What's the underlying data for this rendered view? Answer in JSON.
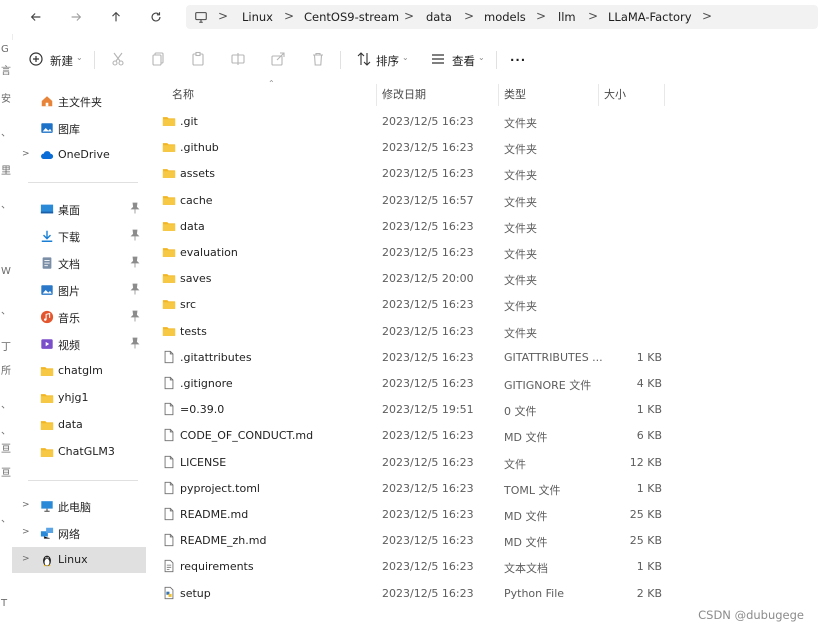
{
  "background_strip": {
    "chars": [
      "G",
      "言",
      "安",
      "、",
      "里",
      "、",
      "W",
      "、",
      "丁",
      "所",
      "、",
      "、",
      "亘",
      "亘",
      "、",
      "T"
    ]
  },
  "address_bar": {
    "back_icon": "arrow-left-icon",
    "forward_icon": "arrow-right-icon",
    "up_icon": "arrow-up-icon",
    "refresh_icon": "refresh-icon",
    "location_icon": "monitor-icon",
    "breadcrumbs": [
      "Linux",
      "CentOS9-stream",
      "data",
      "models",
      "llm",
      "LLaMA-Factory"
    ],
    "separator": ">"
  },
  "toolbar": {
    "new_label": "新建",
    "sort_label": "排序",
    "view_label": "查看",
    "more_label": "···",
    "icons": [
      "plus-circle-icon",
      "cut-icon",
      "copy-icon",
      "paste-icon",
      "rename-icon",
      "share-icon",
      "delete-icon",
      "sort-icon",
      "view-icon"
    ]
  },
  "nav": {
    "items": [
      {
        "label": "主文件夹",
        "icon": "home-icon",
        "color": "#e8833a"
      },
      {
        "label": "图库",
        "icon": "gallery-icon",
        "color": "#1e73c8"
      },
      {
        "label": "OneDrive",
        "icon": "cloud-icon",
        "color": "#0a6cd6",
        "expander": ">"
      },
      {
        "label": "桌面",
        "icon": "desktop-icon",
        "color": "#2b8ad8",
        "pinned": true
      },
      {
        "label": "下载",
        "icon": "download-icon",
        "color": "#1a7fd4",
        "pinned": true
      },
      {
        "label": "文档",
        "icon": "document-icon",
        "color": "#7a8ea6",
        "pinned": true
      },
      {
        "label": "图片",
        "icon": "pictures-icon",
        "color": "#2a78c7",
        "pinned": true
      },
      {
        "label": "音乐",
        "icon": "music-icon",
        "color": "#e4572e",
        "pinned": true
      },
      {
        "label": "视频",
        "icon": "video-icon",
        "color": "#7b4fc9",
        "pinned": true
      },
      {
        "label": "chatglm",
        "icon": "folder-icon",
        "color": "#f2b624"
      },
      {
        "label": "yhjg1",
        "icon": "folder-icon",
        "color": "#f2b624"
      },
      {
        "label": "data",
        "icon": "folder-icon",
        "color": "#f2b624"
      },
      {
        "label": "ChatGLM3",
        "icon": "folder-icon",
        "color": "#f2b624"
      },
      {
        "label": "此电脑",
        "icon": "computer-icon",
        "color": "#2b8ad8",
        "expander": ">"
      },
      {
        "label": "网络",
        "icon": "network-icon",
        "color": "#2b8ad8",
        "expander": ">"
      },
      {
        "label": "Linux",
        "icon": "tux-icon",
        "color": "#222222",
        "expander": ">",
        "selected": true
      }
    ]
  },
  "columns": {
    "name": "名称",
    "modified": "修改日期",
    "type": "类型",
    "size": "大小"
  },
  "files": [
    {
      "name": ".git",
      "modified": "2023/12/5 16:23",
      "type": "文件夹",
      "size": "",
      "kind": "folder"
    },
    {
      "name": ".github",
      "modified": "2023/12/5 16:23",
      "type": "文件夹",
      "size": "",
      "kind": "folder"
    },
    {
      "name": "assets",
      "modified": "2023/12/5 16:23",
      "type": "文件夹",
      "size": "",
      "kind": "folder"
    },
    {
      "name": "cache",
      "modified": "2023/12/5 16:57",
      "type": "文件夹",
      "size": "",
      "kind": "folder"
    },
    {
      "name": "data",
      "modified": "2023/12/5 16:23",
      "type": "文件夹",
      "size": "",
      "kind": "folder"
    },
    {
      "name": "evaluation",
      "modified": "2023/12/5 16:23",
      "type": "文件夹",
      "size": "",
      "kind": "folder"
    },
    {
      "name": "saves",
      "modified": "2023/12/5 20:00",
      "type": "文件夹",
      "size": "",
      "kind": "folder"
    },
    {
      "name": "src",
      "modified": "2023/12/5 16:23",
      "type": "文件夹",
      "size": "",
      "kind": "folder"
    },
    {
      "name": "tests",
      "modified": "2023/12/5 16:23",
      "type": "文件夹",
      "size": "",
      "kind": "folder"
    },
    {
      "name": ".gitattributes",
      "modified": "2023/12/5 16:23",
      "type": "GITATTRIBUTES ...",
      "size": "1 KB",
      "kind": "file"
    },
    {
      "name": ".gitignore",
      "modified": "2023/12/5 16:23",
      "type": "GITIGNORE 文件",
      "size": "4 KB",
      "kind": "file"
    },
    {
      "name": "=0.39.0",
      "modified": "2023/12/5 19:51",
      "type": "0 文件",
      "size": "1 KB",
      "kind": "file"
    },
    {
      "name": "CODE_OF_CONDUCT.md",
      "modified": "2023/12/5 16:23",
      "type": "MD 文件",
      "size": "6 KB",
      "kind": "file"
    },
    {
      "name": "LICENSE",
      "modified": "2023/12/5 16:23",
      "type": "文件",
      "size": "12 KB",
      "kind": "file"
    },
    {
      "name": "pyproject.toml",
      "modified": "2023/12/5 16:23",
      "type": "TOML 文件",
      "size": "1 KB",
      "kind": "file"
    },
    {
      "name": "README.md",
      "modified": "2023/12/5 16:23",
      "type": "MD 文件",
      "size": "25 KB",
      "kind": "file"
    },
    {
      "name": "README_zh.md",
      "modified": "2023/12/5 16:23",
      "type": "MD 文件",
      "size": "25 KB",
      "kind": "file"
    },
    {
      "name": "requirements",
      "modified": "2023/12/5 16:23",
      "type": "文本文档",
      "size": "1 KB",
      "kind": "text"
    },
    {
      "name": "setup",
      "modified": "2023/12/5 16:23",
      "type": "Python File",
      "size": "2 KB",
      "kind": "python"
    }
  ],
  "watermark": "CSDN @dubugege",
  "colors": {
    "folder": "#f2b624",
    "selected": "#e0e0e0",
    "breadcrumb_bg": "#f2f2f2"
  }
}
